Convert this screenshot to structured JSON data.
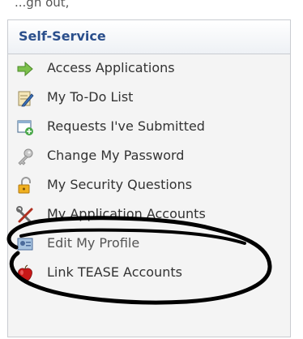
{
  "page_top_text": "...gn out, ",
  "panel": {
    "title": "Self-Service",
    "items": [
      {
        "label": "Access Applications",
        "icon": "green-arrow-icon"
      },
      {
        "label": "My To-Do List",
        "icon": "notepad-pencil-icon"
      },
      {
        "label": "Requests I've Submitted",
        "icon": "window-add-icon"
      },
      {
        "label": "Change My Password",
        "icon": "key-icon"
      },
      {
        "label": "My Security Questions",
        "icon": "padlock-icon"
      },
      {
        "label": "My Application Accounts",
        "icon": "tools-icon"
      },
      {
        "label": "Edit My Profile",
        "icon": "profile-card-icon"
      },
      {
        "label": "Link TEASE Accounts",
        "icon": "red-apple-icon"
      }
    ]
  },
  "colors": {
    "title": "#2b4f8c",
    "panel_bg": "#f4f4f4",
    "border": "#c9ccd1",
    "annotation": "#000000"
  }
}
